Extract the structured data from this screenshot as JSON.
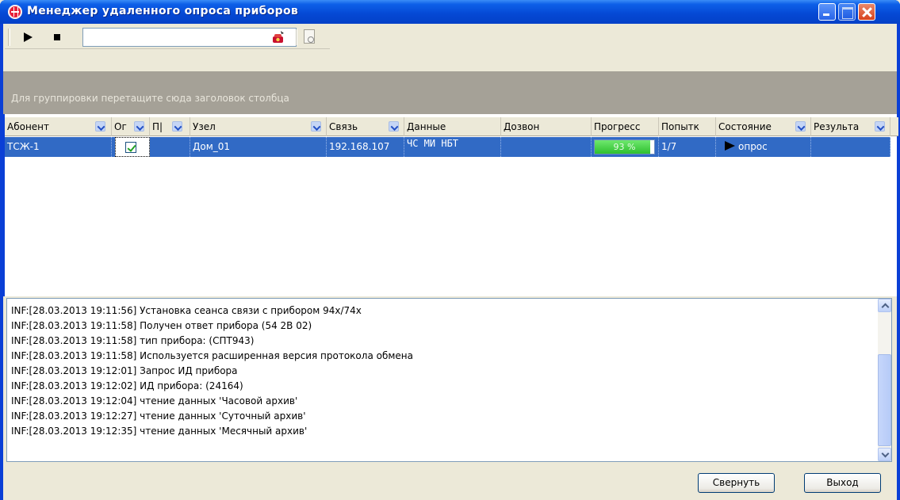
{
  "window": {
    "title": "Менеджер удаленного опроса приборов"
  },
  "toolbar": {
    "search_value": "",
    "icons": [
      "play-icon",
      "stop-icon",
      "phone-call-icon",
      "document-preview-icon"
    ]
  },
  "group_panel": {
    "hint": "Для группировки перетащите сюда заголовок столбца"
  },
  "grid": {
    "columns": [
      "Абонент",
      "Ог",
      "П|",
      "Узел",
      "Связь",
      "Данные",
      "Дозвон",
      "Прогресс",
      "Попытк",
      "Состояние",
      "Результа"
    ],
    "rows": [
      {
        "subscriber": "ТСЖ-1",
        "checked": true,
        "node": "Дом_01",
        "connection": "192.168.107",
        "data": "ЧС МИ НБТ",
        "dial": "",
        "progress_text": "93 %",
        "progress_value": 93,
        "attempts": "1/7",
        "state": "опрос",
        "result": ""
      }
    ]
  },
  "log": {
    "lines": [
      "INF:[28.03.2013 19:11:56] Установка сеанса связи с прибором 94x/74x",
      "INF:[28.03.2013 19:11:58] Получен ответ прибора (54 2B 02)",
      "INF:[28.03.2013 19:11:58] тип прибора: (СПТ943)",
      "INF:[28.03.2013 19:11:58] Используется расширенная версия протокола обмена",
      "INF:[28.03.2013 19:12:01] Запрос ИД прибора",
      "INF:[28.03.2013 19:12:02] ИД прибора: (24164)",
      "INF:[28.03.2013 19:12:04] чтение данных 'Часовой архив'",
      "INF:[28.03.2013 19:12:27] чтение данных 'Суточный архив'",
      "INF:[28.03.2013 19:12:35] чтение данных 'Месячный архив'"
    ]
  },
  "footer": {
    "collapse_label": "Свернуть",
    "exit_label": "Выход"
  },
  "colors": {
    "titlebar": "#0548d4",
    "selection": "#316ac5",
    "progress": "#2fbf2f",
    "group_panel": "#a5a197"
  }
}
